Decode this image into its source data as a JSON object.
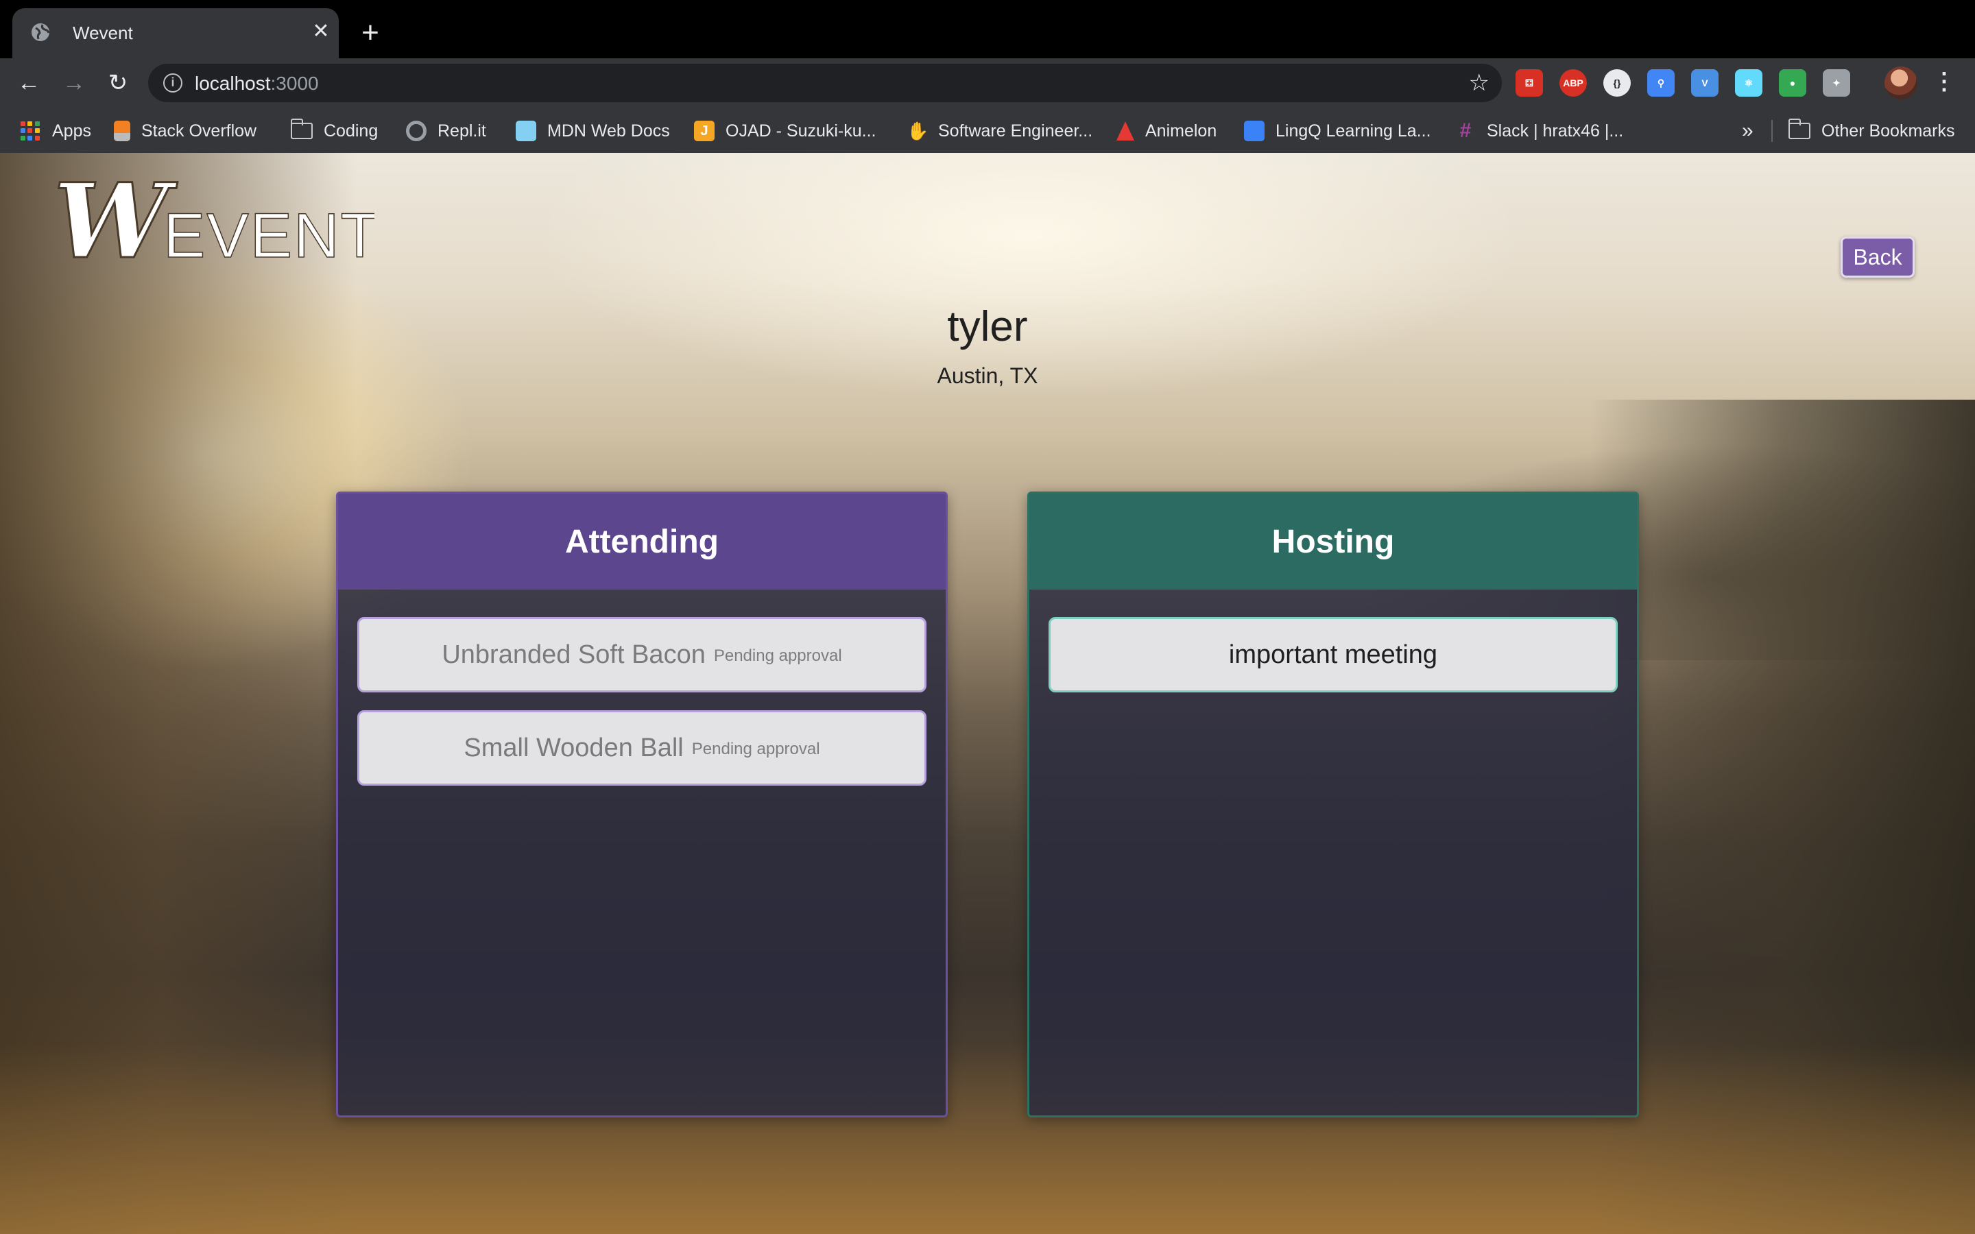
{
  "browser": {
    "tab_title": "Wevent",
    "new_tab_label": "+",
    "url_host": "localhost",
    "url_port": ":3000",
    "bookmarks": [
      {
        "label": "Apps",
        "icon": "apps-grid-icon"
      },
      {
        "label": "Stack Overflow",
        "icon": "stackoverflow-icon",
        "color": "#f48024"
      },
      {
        "label": "Coding",
        "icon": "folder-icon"
      },
      {
        "label": "Repl.it",
        "icon": "replit-icon",
        "color": "#9aa0a6"
      },
      {
        "label": "MDN Web Docs",
        "icon": "mdn-icon",
        "color": "#83d0f2"
      },
      {
        "label": "OJAD - Suzuki-ku...",
        "icon": "ojad-icon",
        "color": "#f5a623"
      },
      {
        "label": "Software Engineer...",
        "icon": "hand-icon",
        "color": "#e0a050"
      },
      {
        "label": "Animelon",
        "icon": "animelon-icon",
        "color": "#e53935"
      },
      {
        "label": "LingQ Learning La...",
        "icon": "lingq-icon",
        "color": "#3b82f6"
      },
      {
        "label": "Slack | hratx46 |...",
        "icon": "slack-icon",
        "color": "#a0449b"
      }
    ],
    "overflow_label": "»",
    "other_bookmarks": "Other Bookmarks",
    "extensions": [
      {
        "name": "red-ext-icon",
        "color": "#d93025",
        "glyph": "⚃"
      },
      {
        "name": "adblock-icon",
        "color": "#d93025",
        "glyph": "ABP"
      },
      {
        "name": "json-ext-icon",
        "color": "#e8eaed",
        "glyph": "{}"
      },
      {
        "name": "blue-ext-icon",
        "color": "#4285f4",
        "glyph": "⚲"
      },
      {
        "name": "vimium-icon",
        "color": "#4a90e2",
        "glyph": "V"
      },
      {
        "name": "react-devtools-icon",
        "color": "#61dafb",
        "glyph": "⚛"
      },
      {
        "name": "frog-ext-icon",
        "color": "#34a853",
        "glyph": "●"
      },
      {
        "name": "puzzle-ext-icon",
        "color": "#9aa0a6",
        "glyph": "✦"
      }
    ]
  },
  "app": {
    "logo_text": "WEVENT",
    "back_label": "Back",
    "user_name": "tyler",
    "user_location": "Austin, TX",
    "accent_attending": "#5c478e",
    "accent_hosting": "#2b6b62"
  },
  "attending": {
    "title": "Attending",
    "events": [
      {
        "title": "Unbranded Soft Bacon",
        "status": "Pending approval"
      },
      {
        "title": "Small Wooden Ball",
        "status": "Pending approval"
      }
    ]
  },
  "hosting": {
    "title": "Hosting",
    "events": [
      {
        "title": "important meeting"
      }
    ]
  }
}
